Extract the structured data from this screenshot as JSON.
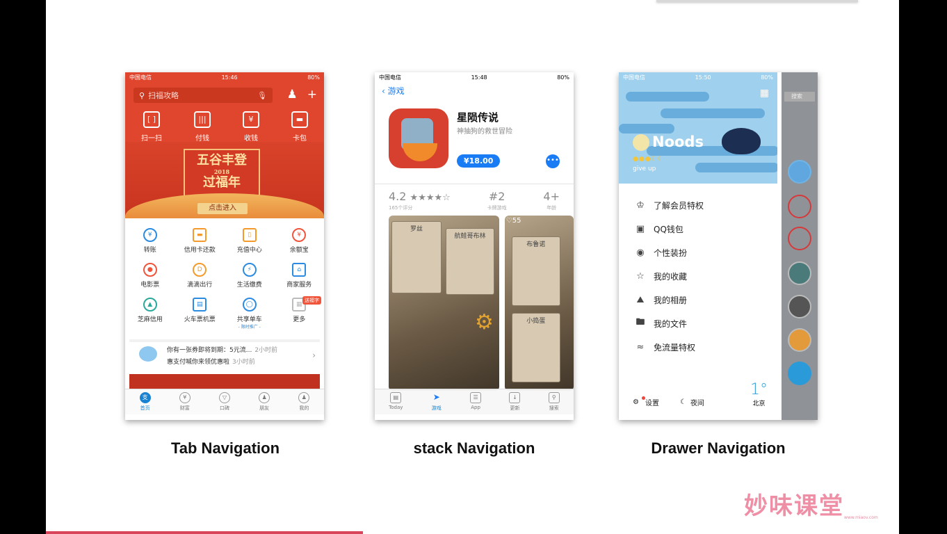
{
  "captions": {
    "tab": "Tab Navigation",
    "stack": "stack Navigation",
    "drawer": "Drawer Navigation"
  },
  "statusbar": {
    "carrier": "中国电信",
    "battery": "80%",
    "time1": "15:46",
    "time2": "15:48",
    "time3": "15:50"
  },
  "alipay": {
    "search_placeholder": "扫福攻略",
    "quick_actions": [
      "扫一扫",
      "付钱",
      "收钱",
      "卡包"
    ],
    "banner": {
      "title_line1": "五谷丰登",
      "year": "2018",
      "title_line2": "过福年",
      "button": "点击进入"
    },
    "services": [
      "转账",
      "信用卡还款",
      "充值中心",
      "余额宝",
      "电影票",
      "滴滴出行",
      "生活缴费",
      "商家服务",
      "芝麻信用",
      "火车票机票",
      "共享单车",
      "更多"
    ],
    "service_badge": "送福字",
    "share_bike_sub": "- 限时推广 -",
    "notices": [
      {
        "text": "你有一张券即将到期：5元流...",
        "time": "2小时前"
      },
      {
        "text": "惠支付喊你来领优惠啦",
        "time": "3小时前"
      }
    ],
    "tabs": [
      "首页",
      "财富",
      "口碑",
      "朋友",
      "我的"
    ]
  },
  "appstore": {
    "back_label": "游戏",
    "app_name": "星陨传说",
    "app_subtitle": "神抽狗的救世冒险",
    "price": "¥18.00",
    "rating": "4.2",
    "stars": "★★★★☆",
    "rating_count": "165个评分",
    "rank": "#2",
    "rank_label": "卡牌游戏",
    "age": "4+",
    "age_label": "年龄",
    "card_names": [
      "罗丝",
      "航鲑哥布林",
      "布鲁诺",
      "小捣蛋"
    ],
    "likes": "♡55",
    "tabs": [
      "Today",
      "游戏",
      "App",
      "更新",
      "搜索"
    ]
  },
  "qq": {
    "nickname": "Noods",
    "signature": "give up",
    "menu": [
      "了解会员特权",
      "QQ钱包",
      "个性装扮",
      "我的收藏",
      "我的相册",
      "我的文件",
      "免流量特权"
    ],
    "settings": "设置",
    "night": "夜间",
    "temperature": "1°",
    "city": "北京",
    "side_search": "搜索"
  },
  "brand": {
    "logo": "妙味课堂",
    "url": "www.miaov.com"
  },
  "colors": {
    "alipay_red": "#e0452e",
    "ios_blue": "#1a7cf5",
    "qq_blue": "#9fd0ee",
    "accent_pink": "#d9455b"
  }
}
